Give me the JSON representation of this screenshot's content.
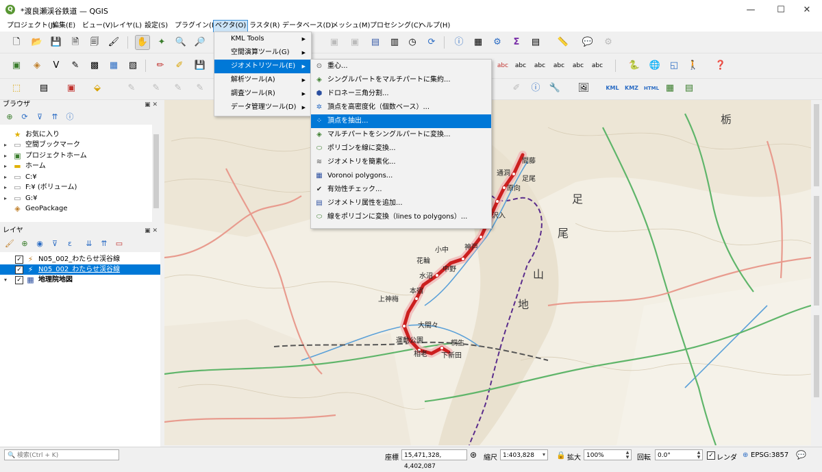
{
  "window": {
    "title": "*渡良瀬渓谷鉄道 — QGIS",
    "app_icon": "Q",
    "min": "—",
    "max": "☐",
    "close": "✕"
  },
  "menubar": [
    "プロジェクト(J)",
    "編集(E)",
    "ビュー(V)",
    "レイヤ(L)",
    "設定(S)",
    "プラグイン(P)",
    "ベクタ(O)",
    "ラスタ(R)",
    "データベース(D)",
    "メッシュ(M)",
    "プロセシング(C)",
    "ヘルプ(H)"
  ],
  "vector_menu": {
    "items": [
      {
        "label": "KML Tools",
        "submenu": true
      },
      {
        "label": "空間演算ツール(G)",
        "submenu": true
      },
      {
        "label": "ジオメトリツール(E)",
        "submenu": true,
        "highlighted": true
      },
      {
        "label": "解析ツール(A)",
        "submenu": true
      },
      {
        "label": "調査ツール(R)",
        "submenu": true
      },
      {
        "label": "データ管理ツール(D)",
        "submenu": true
      }
    ]
  },
  "geometry_submenu": {
    "items": [
      {
        "label": "重心...",
        "icon": "centroid-icon",
        "glyph": "⊙"
      },
      {
        "label": "シングルパートをマルチパートに集約...",
        "icon": "singleparts-to-multipart-icon",
        "glyph": "◈"
      },
      {
        "label": "ドロネー三角分割...",
        "icon": "delaunay-icon",
        "glyph": "⬢"
      },
      {
        "label": "頂点を高密度化（個数ベース）...",
        "icon": "densify-icon",
        "glyph": "✲"
      },
      {
        "label": "頂点を抽出...",
        "icon": "extract-vertices-icon",
        "glyph": "⁘",
        "highlighted": true
      },
      {
        "label": "マルチパートをシングルパートに変換...",
        "icon": "multipart-to-singleparts-icon",
        "glyph": "◈"
      },
      {
        "label": "ポリゴンを線に変換...",
        "icon": "polygons-to-lines-icon",
        "glyph": "⬭"
      },
      {
        "label": "ジオメトリを簡素化...",
        "icon": "simplify-icon",
        "glyph": "≋"
      },
      {
        "label": "Voronoi polygons...",
        "icon": "voronoi-icon",
        "glyph": "▦"
      },
      {
        "label": "有効性チェック...",
        "icon": "check-validity-icon",
        "glyph": "✔"
      },
      {
        "label": "ジオメトリ属性を追加...",
        "icon": "add-geometry-attributes-icon",
        "glyph": "▤"
      },
      {
        "label": "線をポリゴンに変換（lines to polygons）...",
        "icon": "lines-to-polygons-icon",
        "glyph": "⬭"
      }
    ]
  },
  "browser": {
    "title": "ブラウザ",
    "items": [
      {
        "label": "お気に入り",
        "icon": "star-icon",
        "expandable": false
      },
      {
        "label": "空間ブックマーク",
        "icon": "bookmark-icon",
        "expandable": true
      },
      {
        "label": "プロジェクトホーム",
        "icon": "project-home-icon",
        "expandable": true
      },
      {
        "label": "ホーム",
        "icon": "home-folder-icon",
        "expandable": true
      },
      {
        "label": "C:¥",
        "icon": "folder-icon",
        "expandable": true
      },
      {
        "label": "F:¥ (ボリューム)",
        "icon": "folder-icon",
        "expandable": true
      },
      {
        "label": "G:¥",
        "icon": "folder-icon",
        "expandable": true
      },
      {
        "label": "GeoPackage",
        "icon": "geopackage-icon",
        "expandable": false
      }
    ]
  },
  "layers": {
    "title": "レイヤ",
    "items": [
      {
        "label": "N05_002_わたらせ渓谷線",
        "checked": true,
        "selected": false,
        "icon": "line-layer-icon"
      },
      {
        "label": "N05_002_わたらせ渓谷線",
        "checked": true,
        "selected": true,
        "icon": "line-layer-icon"
      },
      {
        "label": "地理院地図",
        "checked": true,
        "selected": false,
        "icon": "raster-layer-icon"
      }
    ]
  },
  "map": {
    "line_color": "#cc1f1f",
    "labels": [
      "間藤",
      "通洞",
      "足尾",
      "原向",
      "沢入",
      "神戸",
      "小中",
      "花輪",
      "中野",
      "水沼",
      "本宿",
      "上神梅",
      "大間々",
      "運動公園",
      "相老",
      "桐生",
      "下新田",
      "足",
      "尾",
      "山",
      "地",
      "栃"
    ]
  },
  "statusbar": {
    "search_placeholder": "検索(Ctrl + K)",
    "coord_label": "座標",
    "coord_value": "15,471,328, 4,402,087",
    "scale_label": "縮尺",
    "scale_value": "1:403,828",
    "magnifier_label": "拡大",
    "magnifier_value": "100%",
    "rotation_label": "回転",
    "rotation_value": "0.0°",
    "render_label": "レンダ",
    "crs": "EPSG:3857"
  }
}
